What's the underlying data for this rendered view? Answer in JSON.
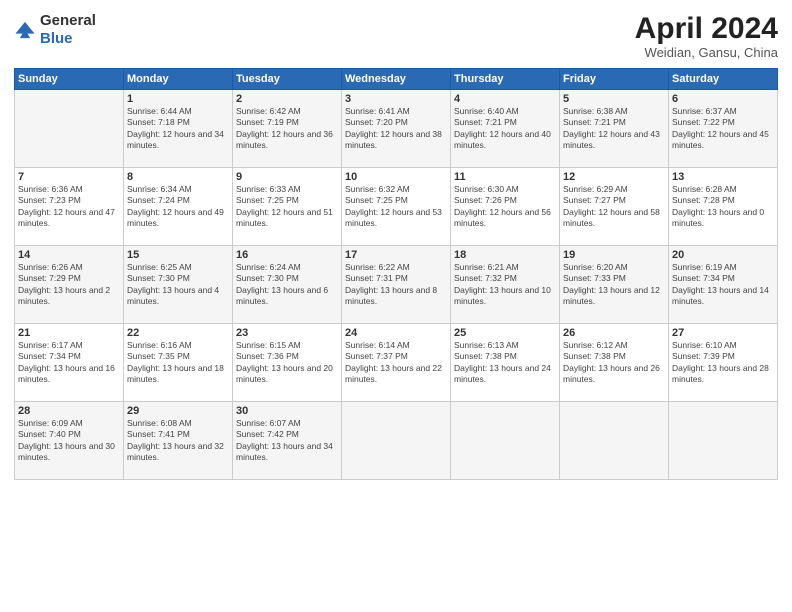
{
  "header": {
    "logo": {
      "general": "General",
      "blue": "Blue"
    },
    "title": "April 2024",
    "location": "Weidian, Gansu, China"
  },
  "weekdays": [
    "Sunday",
    "Monday",
    "Tuesday",
    "Wednesday",
    "Thursday",
    "Friday",
    "Saturday"
  ],
  "weeks": [
    [
      {
        "day": "",
        "sunrise": "",
        "sunset": "",
        "daylight": ""
      },
      {
        "day": "1",
        "sunrise": "Sunrise: 6:44 AM",
        "sunset": "Sunset: 7:18 PM",
        "daylight": "Daylight: 12 hours and 34 minutes."
      },
      {
        "day": "2",
        "sunrise": "Sunrise: 6:42 AM",
        "sunset": "Sunset: 7:19 PM",
        "daylight": "Daylight: 12 hours and 36 minutes."
      },
      {
        "day": "3",
        "sunrise": "Sunrise: 6:41 AM",
        "sunset": "Sunset: 7:20 PM",
        "daylight": "Daylight: 12 hours and 38 minutes."
      },
      {
        "day": "4",
        "sunrise": "Sunrise: 6:40 AM",
        "sunset": "Sunset: 7:21 PM",
        "daylight": "Daylight: 12 hours and 40 minutes."
      },
      {
        "day": "5",
        "sunrise": "Sunrise: 6:38 AM",
        "sunset": "Sunset: 7:21 PM",
        "daylight": "Daylight: 12 hours and 43 minutes."
      },
      {
        "day": "6",
        "sunrise": "Sunrise: 6:37 AM",
        "sunset": "Sunset: 7:22 PM",
        "daylight": "Daylight: 12 hours and 45 minutes."
      }
    ],
    [
      {
        "day": "7",
        "sunrise": "Sunrise: 6:36 AM",
        "sunset": "Sunset: 7:23 PM",
        "daylight": "Daylight: 12 hours and 47 minutes."
      },
      {
        "day": "8",
        "sunrise": "Sunrise: 6:34 AM",
        "sunset": "Sunset: 7:24 PM",
        "daylight": "Daylight: 12 hours and 49 minutes."
      },
      {
        "day": "9",
        "sunrise": "Sunrise: 6:33 AM",
        "sunset": "Sunset: 7:25 PM",
        "daylight": "Daylight: 12 hours and 51 minutes."
      },
      {
        "day": "10",
        "sunrise": "Sunrise: 6:32 AM",
        "sunset": "Sunset: 7:25 PM",
        "daylight": "Daylight: 12 hours and 53 minutes."
      },
      {
        "day": "11",
        "sunrise": "Sunrise: 6:30 AM",
        "sunset": "Sunset: 7:26 PM",
        "daylight": "Daylight: 12 hours and 56 minutes."
      },
      {
        "day": "12",
        "sunrise": "Sunrise: 6:29 AM",
        "sunset": "Sunset: 7:27 PM",
        "daylight": "Daylight: 12 hours and 58 minutes."
      },
      {
        "day": "13",
        "sunrise": "Sunrise: 6:28 AM",
        "sunset": "Sunset: 7:28 PM",
        "daylight": "Daylight: 13 hours and 0 minutes."
      }
    ],
    [
      {
        "day": "14",
        "sunrise": "Sunrise: 6:26 AM",
        "sunset": "Sunset: 7:29 PM",
        "daylight": "Daylight: 13 hours and 2 minutes."
      },
      {
        "day": "15",
        "sunrise": "Sunrise: 6:25 AM",
        "sunset": "Sunset: 7:30 PM",
        "daylight": "Daylight: 13 hours and 4 minutes."
      },
      {
        "day": "16",
        "sunrise": "Sunrise: 6:24 AM",
        "sunset": "Sunset: 7:30 PM",
        "daylight": "Daylight: 13 hours and 6 minutes."
      },
      {
        "day": "17",
        "sunrise": "Sunrise: 6:22 AM",
        "sunset": "Sunset: 7:31 PM",
        "daylight": "Daylight: 13 hours and 8 minutes."
      },
      {
        "day": "18",
        "sunrise": "Sunrise: 6:21 AM",
        "sunset": "Sunset: 7:32 PM",
        "daylight": "Daylight: 13 hours and 10 minutes."
      },
      {
        "day": "19",
        "sunrise": "Sunrise: 6:20 AM",
        "sunset": "Sunset: 7:33 PM",
        "daylight": "Daylight: 13 hours and 12 minutes."
      },
      {
        "day": "20",
        "sunrise": "Sunrise: 6:19 AM",
        "sunset": "Sunset: 7:34 PM",
        "daylight": "Daylight: 13 hours and 14 minutes."
      }
    ],
    [
      {
        "day": "21",
        "sunrise": "Sunrise: 6:17 AM",
        "sunset": "Sunset: 7:34 PM",
        "daylight": "Daylight: 13 hours and 16 minutes."
      },
      {
        "day": "22",
        "sunrise": "Sunrise: 6:16 AM",
        "sunset": "Sunset: 7:35 PM",
        "daylight": "Daylight: 13 hours and 18 minutes."
      },
      {
        "day": "23",
        "sunrise": "Sunrise: 6:15 AM",
        "sunset": "Sunset: 7:36 PM",
        "daylight": "Daylight: 13 hours and 20 minutes."
      },
      {
        "day": "24",
        "sunrise": "Sunrise: 6:14 AM",
        "sunset": "Sunset: 7:37 PM",
        "daylight": "Daylight: 13 hours and 22 minutes."
      },
      {
        "day": "25",
        "sunrise": "Sunrise: 6:13 AM",
        "sunset": "Sunset: 7:38 PM",
        "daylight": "Daylight: 13 hours and 24 minutes."
      },
      {
        "day": "26",
        "sunrise": "Sunrise: 6:12 AM",
        "sunset": "Sunset: 7:38 PM",
        "daylight": "Daylight: 13 hours and 26 minutes."
      },
      {
        "day": "27",
        "sunrise": "Sunrise: 6:10 AM",
        "sunset": "Sunset: 7:39 PM",
        "daylight": "Daylight: 13 hours and 28 minutes."
      }
    ],
    [
      {
        "day": "28",
        "sunrise": "Sunrise: 6:09 AM",
        "sunset": "Sunset: 7:40 PM",
        "daylight": "Daylight: 13 hours and 30 minutes."
      },
      {
        "day": "29",
        "sunrise": "Sunrise: 6:08 AM",
        "sunset": "Sunset: 7:41 PM",
        "daylight": "Daylight: 13 hours and 32 minutes."
      },
      {
        "day": "30",
        "sunrise": "Sunrise: 6:07 AM",
        "sunset": "Sunset: 7:42 PM",
        "daylight": "Daylight: 13 hours and 34 minutes."
      },
      {
        "day": "",
        "sunrise": "",
        "sunset": "",
        "daylight": ""
      },
      {
        "day": "",
        "sunrise": "",
        "sunset": "",
        "daylight": ""
      },
      {
        "day": "",
        "sunrise": "",
        "sunset": "",
        "daylight": ""
      },
      {
        "day": "",
        "sunrise": "",
        "sunset": "",
        "daylight": ""
      }
    ]
  ]
}
